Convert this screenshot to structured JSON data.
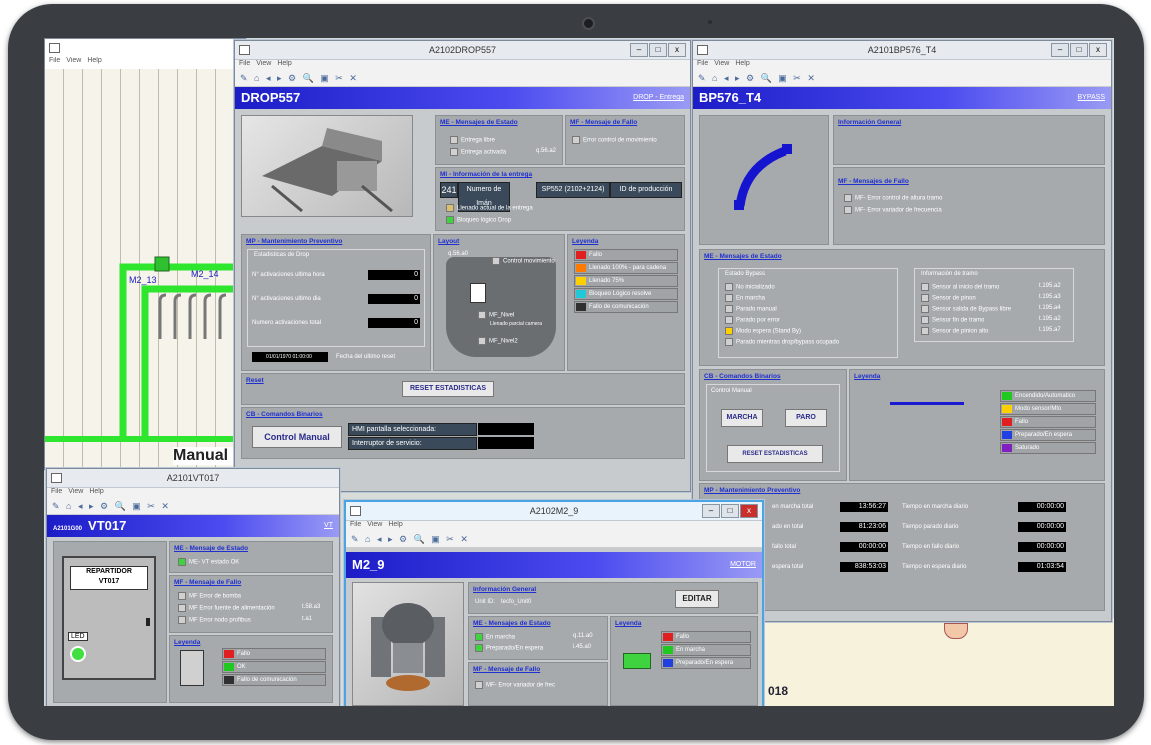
{
  "menu": {
    "file": "File",
    "view": "View",
    "help": "Help"
  },
  "bg": {
    "labels": [
      "M2_13",
      "M2_14"
    ],
    "manual_text": "Manual a",
    "bottom_code": "018"
  },
  "drop": {
    "title": "A2102DROP557",
    "header": "DROP557",
    "header_link": "DROP - Entrega",
    "estado_title": "ME - Mensajes de Estado",
    "estado_items": [
      "Entrega libre",
      "Entrega activada"
    ],
    "estado_code": "q.56.a2",
    "fallo_title": "MF - Mensaje de Fallo",
    "fallo_items": [
      "Error control de movimiento"
    ],
    "info_title": "MI - Información de la entrega",
    "info_num": "241",
    "info_imanlabel": "Numero de Imán",
    "info_code": "SP552 (2102+2124)",
    "info_prod": "ID de producción",
    "info_items": [
      "Llenado actual de la entrega",
      "Bloqueo lógico Drop"
    ],
    "mp_title": "MP - Mantenimiento Preventivo",
    "stats_title": "Estadisticas de Drop",
    "stats": [
      {
        "label": "N° activaciones ultima hora",
        "value": "0"
      },
      {
        "label": "N° activaciones ultimo dia",
        "value": "0"
      },
      {
        "label": "Numero activaciones total",
        "value": "0"
      }
    ],
    "reset_date": "01/01/1970 01:00:00",
    "reset_label": "Fecha del ultimo reset",
    "layout_title": "Layout",
    "layout_code": "q.56.a0",
    "layout_items": [
      "Control movimiento",
      "MF_Nivel",
      "MF_Nivel2"
    ],
    "layout_sub": "Llenado parcial camera",
    "leyenda_title": "Leyenda",
    "leyenda": [
      {
        "label": "Fallo",
        "color": "#e02020"
      },
      {
        "label": "Llenado 100% - para cadena",
        "color": "#ff7a00"
      },
      {
        "label": "Llenado 75%",
        "color": "#ffd000"
      },
      {
        "label": "Bloqueo Lógico resolve",
        "color": "#20c8d8"
      },
      {
        "label": "Fallo de comunicación",
        "color": "#303030"
      }
    ],
    "reset_section": "Reset",
    "reset_btn": "RESET ESTADISTICAS",
    "cb_title": "CB - Comandos Binarios",
    "control_manual": "Control Manual",
    "hmi_label": "HMI pantalla seleccionada:",
    "interruptor_label": "Interruptor de servicio:"
  },
  "bp": {
    "title": "A2101BP576_T4",
    "header": "BP576_T4",
    "header_link": "BYPASS",
    "info_title": "Información General",
    "fallo_title": "MF - Mensajes de Fallo",
    "fallo_items": [
      "MF- Error control de altura tramo",
      "MF- Error variador de frecuencia"
    ],
    "estado_title": "ME - Mensajes de Estado",
    "estado_group": "Estado Bypass",
    "estado_items": [
      "No inicializado",
      "En marcha",
      "Parado manual",
      "Parado por error",
      "Modo espera (Stand By)",
      "Parado mientras drop/bypass ocupado"
    ],
    "tramo_group": "Información de tramo",
    "tramo_items": [
      {
        "label": "Sensor al inicio del tramo",
        "code": "t.195.a2"
      },
      {
        "label": "Sensor de pinon",
        "code": "t.195.a3"
      },
      {
        "label": "Sensor salida de Bypass libre",
        "code": "t.195.a4"
      },
      {
        "label": "Sensor fin de tramo",
        "code": "t.195.a2"
      },
      {
        "label": "Sensor de pinion alto",
        "code": "t.195.a7"
      }
    ],
    "cb_title": "CB - Comandos Binarios",
    "control_group": "Control Manual",
    "marcha": "MARCHA",
    "paro": "PARO",
    "reset_btn": "RESET ESTADISTICAS",
    "leyenda_title": "Leyenda",
    "leyenda": [
      {
        "label": "Encendido/Automatico",
        "color": "#20c820"
      },
      {
        "label": "Modo sensor/Mto",
        "color": "#ffd000"
      },
      {
        "label": "Fallo",
        "color": "#e02020"
      },
      {
        "label": "Preparado/En espera",
        "color": "#2040e0"
      },
      {
        "label": "Saturado",
        "color": "#8020c0"
      }
    ],
    "mp_title": "MP - Mantenimiento Preventivo",
    "mp_left": [
      {
        "label": "en marcha total",
        "value": "13:56:27"
      },
      {
        "label": "ado en total",
        "value": "81:23:06"
      },
      {
        "label": "fallo total",
        "value": "00:00:00"
      },
      {
        "label": "espera total",
        "value": "838:53:03"
      }
    ],
    "mp_right": [
      {
        "label": "Tiempo en marcha diario",
        "value": "00:00:00"
      },
      {
        "label": "Tiempo parado diario",
        "value": "00:00:00"
      },
      {
        "label": "Tiempo en fallo diario",
        "value": "00:00:00"
      },
      {
        "label": "Tiempo en espera diario",
        "value": "01:03:54"
      }
    ]
  },
  "vt": {
    "title": "A2101VT017",
    "header_small": "A2101G00",
    "header": "VT017",
    "header_link": "VT",
    "estado_title": "ME - Mensaje de Estado",
    "estado_items": [
      "ME- VT estado OK"
    ],
    "fallo_title": "MF - Mensaje de Fallo",
    "fallo_items": [
      {
        "label": "MF Error de bomba",
        "code": ""
      },
      {
        "label": "MF Error fuente de alimentación",
        "code": "t.58.a3"
      },
      {
        "label": "MF Error nodo profibus",
        "code": "t.a1"
      }
    ],
    "cabinet_title": "REPARTIDOR",
    "cabinet_code": "VT017",
    "led": "LED",
    "leyenda_title": "Leyenda",
    "leyenda": [
      {
        "label": "Fallo",
        "color": "#e02020"
      },
      {
        "label": "OK",
        "color": "#20c820"
      },
      {
        "label": "Fallo de comunicación",
        "color": "#303030"
      }
    ]
  },
  "m2": {
    "title": "A2102M2_9",
    "header": "M2_9",
    "header_link": "MOTOR",
    "info_title": "Información General",
    "unit_label": "Unit ID:",
    "unit_value": "tecfo_Unit0",
    "editar": "EDITAR",
    "estado_title": "ME - Mensajes de Estado",
    "estado_items": [
      {
        "label": "En marcha",
        "code": "q.11.a0"
      },
      {
        "label": "Preparado/En espera",
        "code": "i.45.a0"
      }
    ],
    "fallo_title": "MF - Mensaje de Fallo",
    "fallo_items": [
      "MF- Error variador de frec"
    ],
    "leyenda_title": "Leyenda",
    "leyenda": [
      {
        "label": "Fallo",
        "color": "#e02020"
      },
      {
        "label": "En marcha",
        "color": "#20c820"
      },
      {
        "label": "Preparado/En espera",
        "color": "#2040e0"
      }
    ]
  }
}
